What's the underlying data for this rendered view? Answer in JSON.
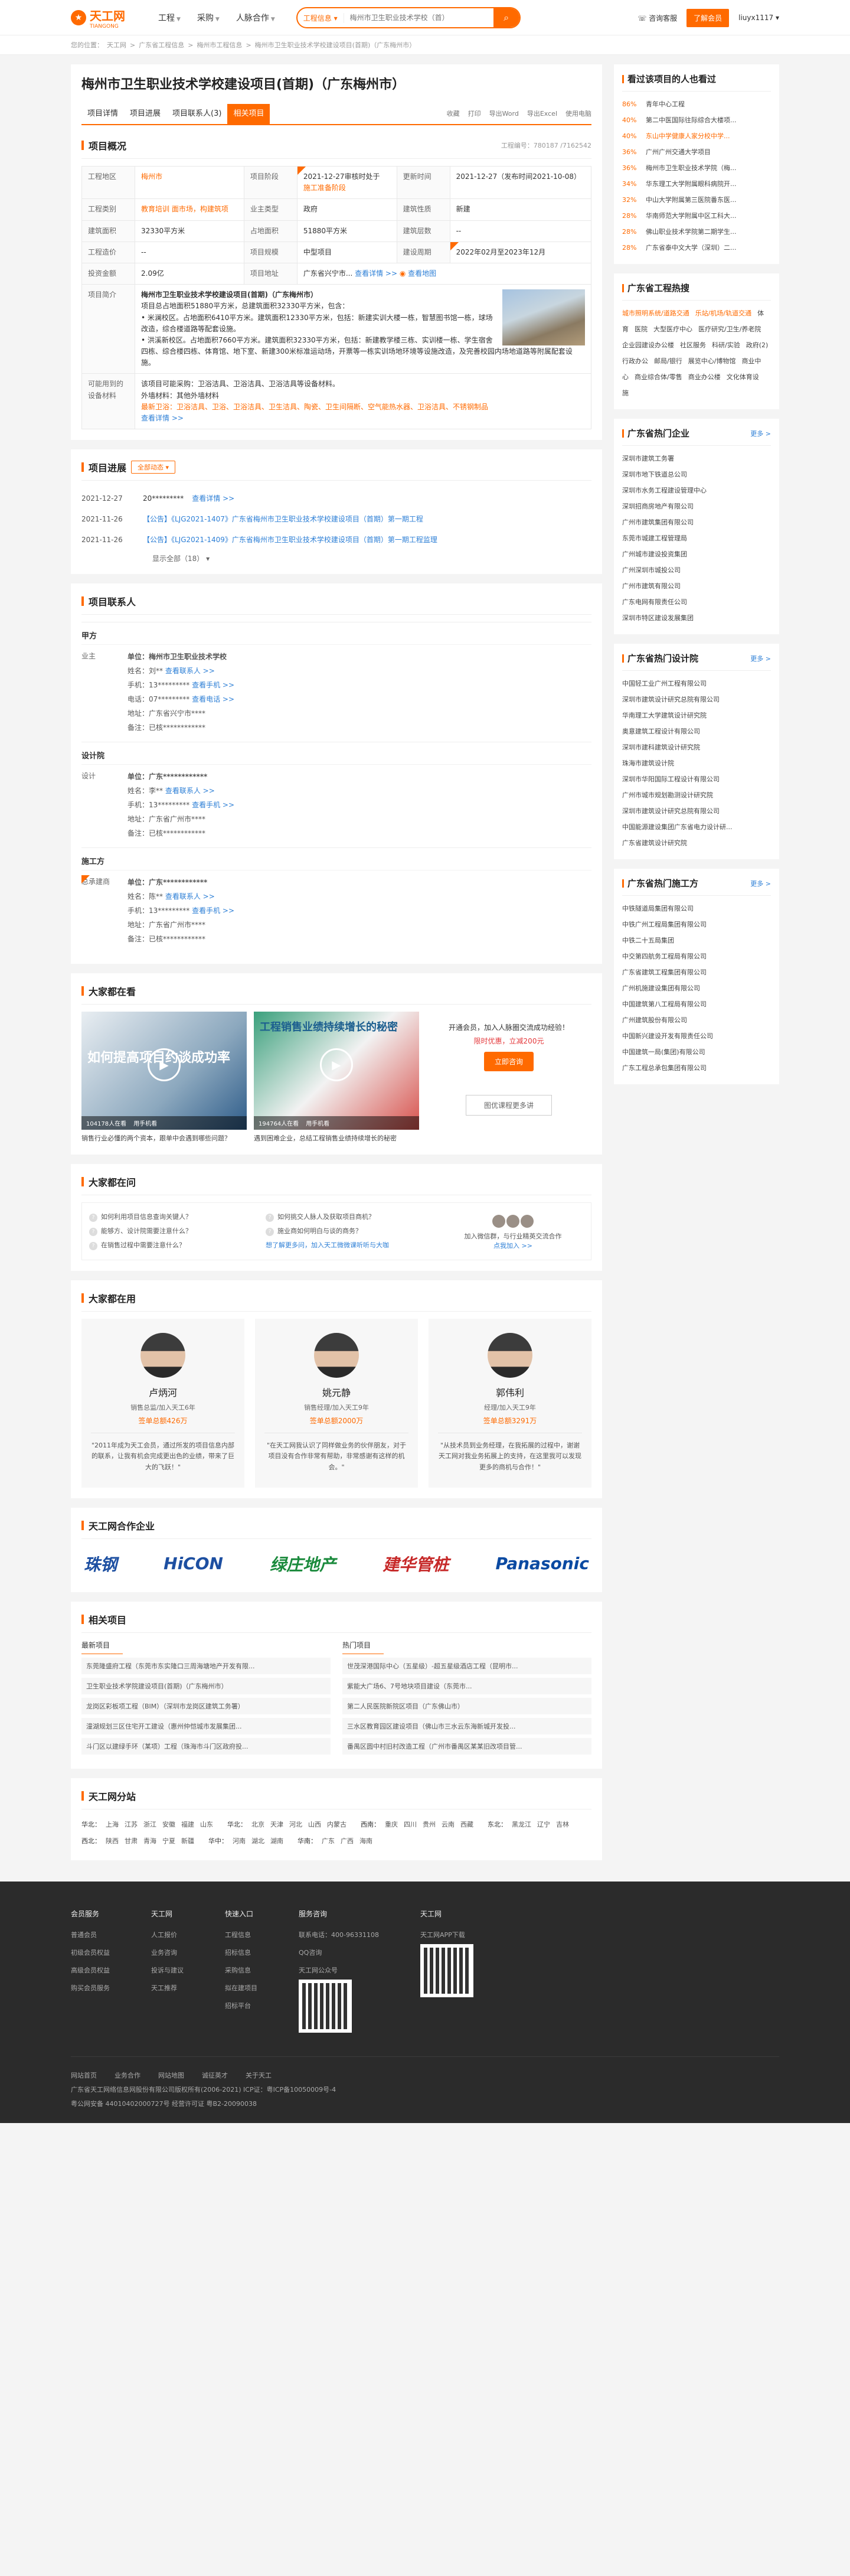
{
  "header": {
    "logo_text": "天工网",
    "logo_sub": "TIANGONG",
    "nav": [
      "工程",
      "采购",
      "人脉合作"
    ],
    "search_category": "工程信息",
    "search_placeholder": "梅州市卫生职业技术学校（首）",
    "consult": "咨询客服",
    "vip": "了解会员",
    "user": "liuyx1117"
  },
  "breadcrumb": [
    "您的位置：",
    "天工网",
    "广东省工程信息",
    "梅州市工程信息",
    "梅州市卫生职业技术学校建设项目(首期)（广东梅州市）"
  ],
  "project": {
    "title": "梅州市卫生职业技术学校建设项目(首期)（广东梅州市）",
    "tabs": [
      "项目详情",
      "项目进展",
      "项目联系人(3)",
      "相关项目"
    ],
    "tools": [
      "收藏",
      "打印",
      "导出Word",
      "导出Excel",
      "使用电脑"
    ],
    "overview_title": "项目概况",
    "project_no": "工程编号：780187 /7162542",
    "info": {
      "region_k": "工程地区",
      "region_v": "梅州市",
      "stage_k": "项目阶段",
      "stage_v1": "2021-12-27审核时处于",
      "stage_v2": "",
      "update_k": "更新时间",
      "update_v": "2021-12-27（发布时间2021-10-08）",
      "cat_k": "工程类别",
      "cat_v": "教育培训 面市场，构建筑项",
      "owner_k": "业主类型",
      "owner_v": "政府",
      "type_k": "建筑性质",
      "type_v": "新建",
      "area_k": "建筑面积",
      "area_v": "32330平方米",
      "land_k": "占地面积",
      "land_v": "51880平方米",
      "floor_k": "建筑层数",
      "floor_v": "--",
      "cost_k": "工程造价",
      "cost_v": "--",
      "scale_k": "项目规模",
      "scale_v": "中型项目",
      "period_k": "建设周期",
      "period_v": "2022年02月至2023年12月",
      "invest_k": "投资金额",
      "invest_v": "2.09亿",
      "addr_k": "项目地址",
      "addr_v": "广东省兴宁市...",
      "addr_link": "查看详情 >>",
      "map_link": "查看地图",
      "intro_k": "项目简介",
      "intro_title": "梅州市卫生职业技术学校建设项目(首期)（广东梅州市）",
      "intro_1": "项目总占地面积51880平方米，总建筑面积32330平方米，包含：",
      "intro_2": "• 米澜校区。占地面积6410平方米。建筑面积12330平方米，包括：新建实训大楼一栋，智慧图书馆一栋，球场改造，综合楼道路等配套设施。",
      "intro_3": "• 洪溪新校区。占地面积7660平方米。建筑面积32330平方米，包括：新建教学楼三栋、实训楼一栋、学生宿舍四栋、综合楼四栋、体育馆、地下室、新建300米标准运动场，开票等一栋实训场地环境等设施改造，及完善校园内场地道路等附属配套设施。",
      "equip_k": "可能用到的设备材料",
      "equip_1": "该项目可能采购：卫浴洁具、卫浴洁具、卫浴洁具等设备材料。",
      "equip_2": "外墙材料：其他外墙材料",
      "equip_3": "最新卫浴：卫浴洁具、卫浴、卫浴洁具、卫生洁具、陶瓷、卫生间隔断、空气能热水器、卫浴洁具、不锈钢制品",
      "equip_link": "查看详情 >>"
    }
  },
  "progress": {
    "title": "项目进展",
    "filter": "全部动态 ▾",
    "items": [
      {
        "date": "2021-12-27",
        "text": "20*********",
        "link": "查看详情 >>"
      },
      {
        "date": "2021-11-26",
        "text": "【公告】《LJG2021-1407》广东省梅州市卫生职业技术学校建设项目（首期）第一期工程"
      },
      {
        "date": "2021-11-26",
        "text": "【公告】《LJG2021-1409》广东省梅州市卫生职业技术学校建设项目（首期）第一期工程监理"
      }
    ],
    "more": "显示全部（18）"
  },
  "contacts": {
    "title": "项目联系人",
    "groups": [
      {
        "title": "甲方",
        "role": "业主",
        "unit": "单位：梅州市卫生职业技术学校",
        "name": "姓名：刘**",
        "name_link": "查看联系人 >>",
        "phone": "手机：13*********",
        "phone_link": "查看手机 >>",
        "tel": "电话：07*********",
        "tel_link": "查看电话 >>",
        "addr": "地址：广东省兴宁市****",
        "note": "备注：已核************"
      },
      {
        "title": "设计院",
        "role": "设计",
        "unit": "单位：广东************",
        "name": "姓名：李**",
        "name_link": "查看联系人 >>",
        "phone": "手机：13*********",
        "phone_link": "查看手机 >>",
        "tel": "",
        "tel_link": "",
        "addr": "地址：广东省广州市****",
        "note": "备注：已核************"
      },
      {
        "title": "施工方",
        "role": "总承建商",
        "unit": "单位：广东************",
        "name": "姓名：陈**",
        "name_link": "查看联系人 >>",
        "phone": "手机：13*********",
        "phone_link": "查看手机 >>",
        "tel": "",
        "tel_link": "",
        "addr": "地址：广东省广州市****",
        "note": "备注：已核************"
      }
    ]
  },
  "watching": {
    "title": "大家都在看",
    "videos": [
      {
        "overlay": "如何提高项目约谈成功率",
        "views": "104178人在看",
        "tag": "用手机看",
        "caption": "销售行业必懂的两个资本，跟单中会遇到哪些问题？"
      },
      {
        "overlay": "工程销售业绩持续增长的秘密",
        "views": "194764人在看",
        "tag": "用手机看",
        "caption": "遇到困难企业，总结工程销售业绩持续增长的秘密"
      }
    ],
    "promo_text": "开通会员，加入人脉圈交流成功经验！",
    "promo_price": "限时优惠，立减200元",
    "promo_btn": "立即咨询",
    "promo_more": "图优课程更多讲"
  },
  "asking": {
    "title": "大家都在问",
    "col1": [
      "如何利用项目信息查询关键人？",
      "能够方、设计院需要注意什么？",
      "在销售过程中需要注意什么？"
    ],
    "col2": [
      "如何挑交人脉人及获取项目商机？",
      "施业商如何明白与谈的商务？",
      "想了解更多问，加入天工微微课听听与大咖"
    ],
    "join": "加入微信群，与行业精英交流合作",
    "join_btn": "点我加入 >>"
  },
  "experts": {
    "title": "大家都在用",
    "list": [
      {
        "name": "卢炳河",
        "role": "销售总监/加入天工6年",
        "deal": "签单总额426万",
        "quote": "\"2011年成为天工会员，通过所发的项目信息内部的联系，让我有机会完成更出色的业绩，带来了巨大的飞跃！\""
      },
      {
        "name": "姚元静",
        "role": "销售经理/加入天工9年",
        "deal": "签单总额2000万",
        "quote": "\"在天工网我认识了同样做业务的伙伴朋友，对于项目没有合作非常有帮助，非常感谢有这样的机会。\""
      },
      {
        "name": "郭伟利",
        "role": "经理/加入天工9年",
        "deal": "签单总额3291万",
        "quote": "\"从技术员到业务经理，在我拓展的过程中，谢谢天工网对我业务拓展上的支持，在这里我可以发现更多的商机与合作！\""
      }
    ]
  },
  "partners": {
    "title": "天工网合作企业",
    "logos": [
      "珠钢",
      "HiCON",
      "绿庄地产",
      "建华管桩",
      "Panasonic"
    ]
  },
  "related": {
    "title": "相关项目",
    "col1_title": "最新项目",
    "col1": [
      "东莞隆盛府工程（东莞市东实隆口三周海塘地产开发有限...",
      "卫生职业技术学院建设项目(首期)（广东梅州市）",
      "龙岗区彩板项工程（BIM）（深圳市龙岗区建筑工务署）",
      "潼湖规划三区住宅开工建设（惠州仲恺城市发展集团...",
      "斗门区以建绿手环（某项）工程（珠海市斗门区政府投..."
    ],
    "col2_title": "热门项目",
    "col2": [
      "世茂深港国际中心（五星级）-超五星级酒店工程（昆明市...",
      "紫能大广场6、7号地块项目建设（东莞市...",
      "第二人民医院新院区项目（广东佛山市）",
      "三水区教育园区建设项目（佛山市三水云东海新城开发投...",
      "番禺区圆中村旧村改造工程（广州市番禺区某某旧改项目管..."
    ]
  },
  "sitemap": {
    "title": "天工网分站",
    "groups": [
      {
        "label": "华北：",
        "items": [
          "上海",
          "江苏",
          "浙江",
          "安徽",
          "福建",
          "山东"
        ]
      },
      {
        "label": "华北：",
        "items": [
          "北京",
          "天津",
          "河北",
          "山西",
          "内蒙古"
        ]
      },
      {
        "label": "西南：",
        "items": [
          "重庆",
          "四川",
          "贵州",
          "云南",
          "西藏"
        ]
      },
      {
        "label": "东北：",
        "items": [
          "黑龙江",
          "辽宁",
          "吉林"
        ]
      },
      {
        "label": "西北：",
        "items": [
          "陕西",
          "甘肃",
          "青海",
          "宁夏",
          "新疆"
        ]
      },
      {
        "label": "华中：",
        "items": [
          "河南",
          "湖北",
          "湖南"
        ]
      },
      {
        "label": "华南：",
        "items": [
          "广东",
          "广西",
          "海南"
        ]
      }
    ]
  },
  "sidebar": {
    "watch_title": "看过该项目的人也看过",
    "watch": [
      {
        "pct": "86%",
        "t": "青年中心工程"
      },
      {
        "pct": "40%",
        "t": "第二中医国际往际综合大楼项..."
      },
      {
        "pct": "40%",
        "t": "东山中学健康人家分校中学..."
      },
      {
        "pct": "36%",
        "t": "广州广州交通大学项目"
      },
      {
        "pct": "36%",
        "t": "梅州市卫生职业技术学院（梅..."
      },
      {
        "pct": "34%",
        "t": "华东理工大学附属眼科病院开..."
      },
      {
        "pct": "32%",
        "t": "中山大学附属第三医院番东医..."
      },
      {
        "pct": "28%",
        "t": "华南师范大学附属中区工科大..."
      },
      {
        "pct": "28%",
        "t": "佛山职业技术学院第二期学生..."
      },
      {
        "pct": "28%",
        "t": "广东省泰中文大学（深圳）二..."
      }
    ],
    "hot_title": "广东省工程热搜",
    "hot": [
      "城市照明系统/道路交通",
      "乐站/机场/轨道交通",
      "体育",
      "医院",
      "大型医疗中心",
      "医疗研究/卫生/养老院",
      "企业园建设办公楼",
      "社区服务",
      "科研/实验",
      "政府(2)行政办公",
      "邮局/银行",
      "展览中心/博物馆",
      "商业中心",
      "商业综合体/零售",
      "商业办公楼",
      "文化体育设施"
    ],
    "corp_title": "广东省热门企业",
    "corp_more": "更多 >",
    "corp": [
      "深圳市建筑工务署",
      "深圳市地下铁道总公司",
      "深圳市水务工程建设管理中心",
      "深圳招商房地产有限公司",
      "广州市建筑集团有限公司",
      "东莞市城建工程管理局",
      "广州城市建设投资集团",
      "广州深圳市城投公司",
      "广州市建筑有限公司",
      "广东电网有限责任公司",
      "深圳市特区建设发展集团"
    ],
    "design_title": "广东省热门设计院",
    "design": [
      "中国轻工业广州工程有限公司",
      "深圳市建筑设计研究总院有限公司",
      "华南理工大学建筑设计研究院",
      "奥意建筑工程设计有限公司",
      "深圳市建科建筑设计研究院",
      "珠海市建筑设计院",
      "深圳市华阳国际工程设计有限公司",
      "广州市城市规划勘测设计研究院",
      "深圳市建筑设计研究总院有限公司",
      "中国能源建设集团广东省电力设计研...",
      "广东省建筑设计研究院"
    ],
    "build_title": "广东省热门施工方",
    "build": [
      "中铁隧道局集团有限公司",
      "中铁广州工程局集团有限公司",
      "中铁二十五局集团",
      "中交第四航务工程局有限公司",
      "广东省建筑工程集团有限公司",
      "广州机施建设集团有限公司",
      "中国建筑第八工程局有限公司",
      "广州建筑股份有限公司",
      "中国新兴建设开发有限责任公司",
      "中国建筑一局(集团)有限公司",
      "广东工程总承包集团有限公司"
    ]
  },
  "footer": {
    "cols": [
      {
        "h": "会员服务",
        "items": [
          "普通会员",
          "初级会员权益",
          "高级会员权益",
          "购买会员服务"
        ]
      },
      {
        "h": "天工网",
        "items": [
          "人工报价",
          "业务咨询",
          "投诉与建议",
          "天工推荐"
        ]
      },
      {
        "h": "快速入口",
        "items": [
          "工程信息",
          "招标信息",
          "采购信息",
          "拟在建项目",
          "招标平台"
        ]
      },
      {
        "h": "服务咨询",
        "items": [
          "联系电话：400-96331108",
          "QQ咨询",
          "天工网公众号"
        ]
      },
      {
        "h": "天工网",
        "items": [
          "天工网APP下载"
        ]
      }
    ],
    "links": [
      "网站首页",
      "业务合作",
      "网站地图",
      "诚征英才",
      "关于天工"
    ],
    "copyright": "广东省天工网络信息网股份有限公司版权所有(2006-2021) ICP证：粤ICP备10050009号-4",
    "icp": "粤公网安备 44010402000727号    经营许可证 粤B2-20090038"
  },
  "colors": {
    "accent": "#ff6a00",
    "link": "#2d7fd6"
  }
}
